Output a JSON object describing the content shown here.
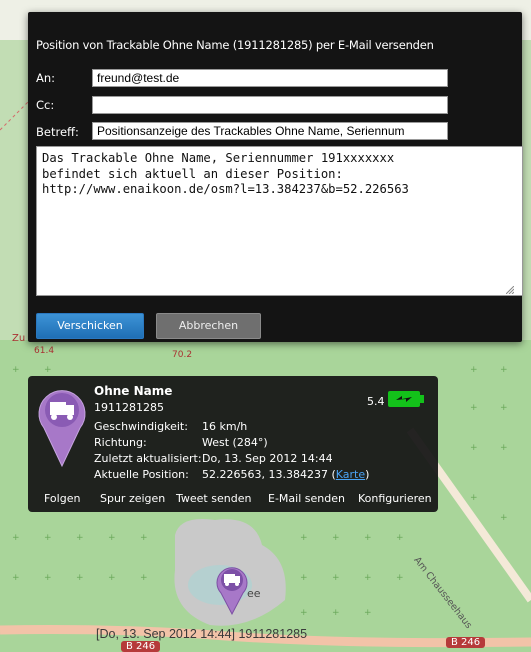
{
  "dialog": {
    "title": "Position von Trackable Ohne Name (1911281285) per E-Mail versenden",
    "to_label": "An:",
    "to_value": "freund@test.de",
    "cc_label": "Cc:",
    "cc_value": "",
    "subject_label": "Betreff:",
    "subject_value": "Positionsanzeige des Trackables Ohne Name, Seriennum",
    "message": "Das Trackable Ohne Name, Seriennummer 191xxxxxxx\nbefindet sich aktuell an dieser Position:\nhttp://www.enaikoon.de/osm?l=13.384237&b=52.226563",
    "send_label": "Verschicken",
    "cancel_label": "Abbrechen"
  },
  "popup": {
    "name": "Ohne Name",
    "id": "1911281285",
    "signal": "5.4",
    "rows": [
      {
        "label": "Geschwindigkeit:",
        "value": "16 km/h"
      },
      {
        "label": "Richtung:",
        "value": "West (284°)"
      },
      {
        "label": "Zuletzt aktualisiert:",
        "value": "Do, 13. Sep 2012 14:44"
      },
      {
        "label": "Aktuelle Position:",
        "value": "52.226563, 13.384237 ("
      }
    ],
    "map_link": "Karte",
    "position_suffix": ")",
    "actions": [
      "Folgen",
      "Spur zeigen",
      "Tweet senden",
      "E-Mail senden",
      "Konfigurieren"
    ]
  },
  "map": {
    "road_label": "Am Chausseehaus",
    "lake_suffix": "ee",
    "route_b246_left": "B 246",
    "route_b246_right": "B 246",
    "elevation_left": "61.4",
    "elevation_mid": "70.2",
    "zu_fragment": "Zu",
    "marker_label": "[Do, 13. Sep 2012 14:44] 1911281285"
  },
  "colors": {
    "forest": "#a9d59a",
    "road": "#f2c3a8",
    "water": "#b5d0d0",
    "pin": "#a778c8",
    "send_button": "#2a7bc3",
    "battery": "#13c11a"
  }
}
